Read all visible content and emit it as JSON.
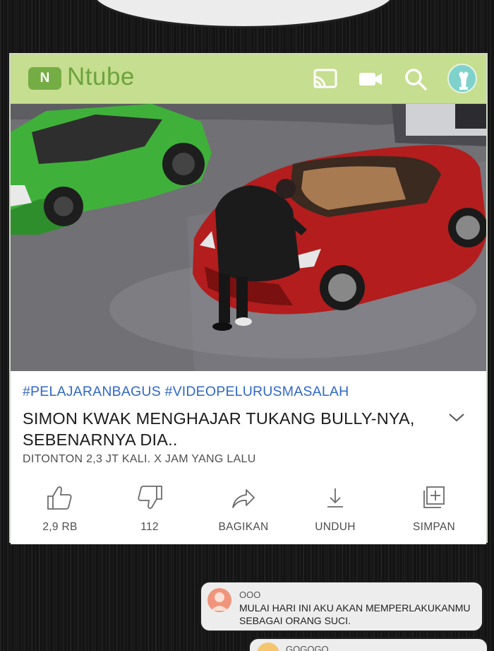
{
  "app": {
    "logo_mark": "N",
    "name": "Ntube",
    "brand_color": "#c6de8f",
    "icons": [
      "cast-icon",
      "video-camera-icon",
      "search-icon",
      "account-avatar"
    ]
  },
  "video": {
    "hashtags": "#PELAJARANBAGUS #VIDEOPELURUSMASALAH",
    "title_line1": "SIMON KWAK MENGHAJAR TUKANG BULLY-NYA,",
    "title_line2": "SEBENARNYA DIA..",
    "meta": "DITONTON 2,3 JT KALI. X JAM YANG LALU"
  },
  "actions": {
    "like": "2,9 RB",
    "dislike": "112",
    "share": "BAGIKAN",
    "download": "UNDUH",
    "save": "SIMPAN"
  },
  "comments": [
    {
      "user": "OOO",
      "text": "MULAI HARI INI AKU AKAN MEMPERLAKUKANMU SEBAGAI ORANG SUCI."
    },
    {
      "user": "GOGOGO",
      "text": ""
    }
  ]
}
